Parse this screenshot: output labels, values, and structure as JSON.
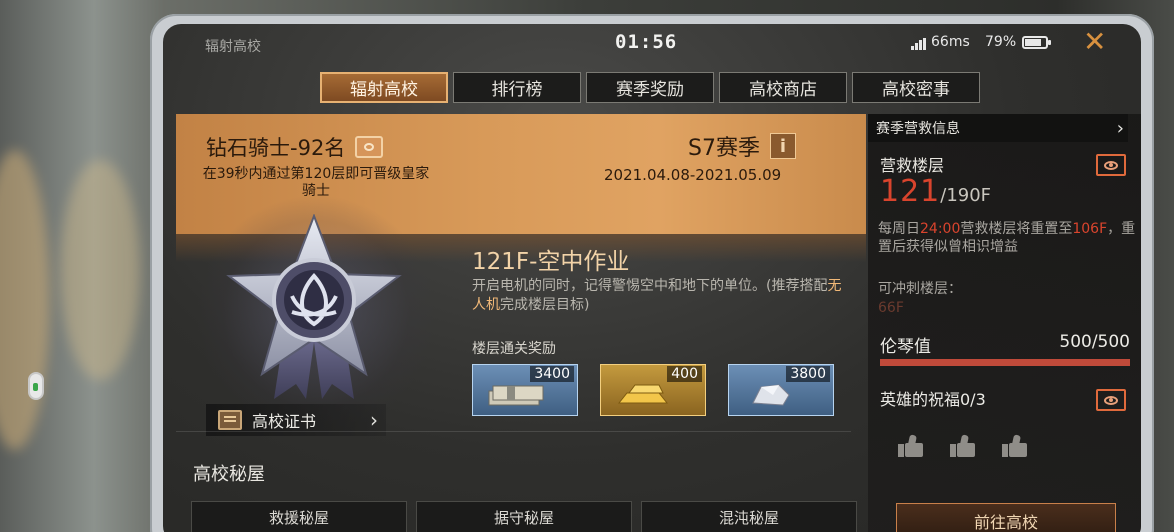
{
  "top_bar": {
    "title": "辐射高校",
    "clock": "01:56",
    "ping": "66ms",
    "battery": "79%",
    "close_icon": "close-icon",
    "accent_color": "#d8913f"
  },
  "tabs": [
    {
      "label": "辐射高校",
      "active": true
    },
    {
      "label": "排行榜",
      "active": false
    },
    {
      "label": "赛季奖励",
      "active": false
    },
    {
      "label": "高校商店",
      "active": false
    },
    {
      "label": "高校密事",
      "active": false
    }
  ],
  "rank": {
    "name": "钻石骑士-92名",
    "description": "在39秒内通过第120层即可晋级皇家骑士",
    "certificate_label": "高校证书"
  },
  "season": {
    "name": "S7赛季",
    "info_icon": "i",
    "dates": "2021.04.08-2021.05.09"
  },
  "floor": {
    "title": "121F-空中作业",
    "description_before": "开启电机的同时，记得警惕空中和地下的单位。(推荐搭配",
    "description_highlight": "无人机",
    "description_after": "完成楼层目标)",
    "reward_label": "楼层通关奖励",
    "rewards": [
      {
        "amount": "3400",
        "icon": "cash-stack-icon"
      },
      {
        "amount": "400",
        "icon": "gold-bar-icon"
      },
      {
        "amount": "3800",
        "icon": "crystal-ore-icon"
      }
    ]
  },
  "secret_rooms": {
    "title": "高校秘屋",
    "rooms": [
      "救援秘屋",
      "据守秘屋",
      "混沌秘屋"
    ]
  },
  "rescue": {
    "header": "赛季营救信息",
    "floor_label": "营救楼层",
    "current_floor": "121",
    "max_floor": "/190F",
    "reset_text_1": "每周日",
    "reset_time": "24:00",
    "reset_text_2": "营救楼层将重置至",
    "reset_floor": "106F",
    "reset_text_3": "，重置后获得似曾相识增益",
    "sprint_label": "可冲刺楼层：",
    "sprint_value": "66F",
    "lunqin_label": "伦琴值",
    "lunqin_value": "500/500",
    "lunqin_fraction": 1.0,
    "blessing_label": "英雄的祝福0/3",
    "goto_button": "前往高校",
    "accent_red": "#d9442d"
  }
}
